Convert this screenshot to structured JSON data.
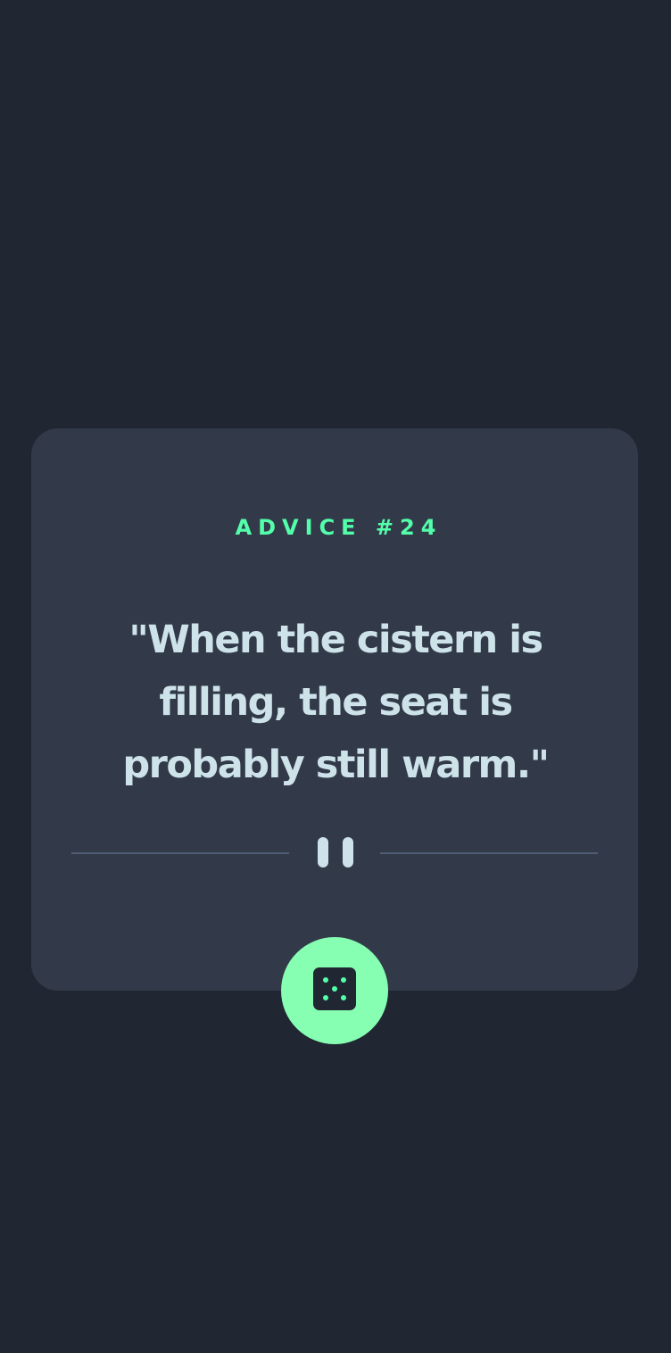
{
  "advice": {
    "label": "ADVICE #24",
    "quote": "\"When the cistern is filling, the seat is probably still warm.\""
  },
  "icons": {
    "divider": "pause-icon",
    "button": "dice-icon"
  },
  "colors": {
    "background": "#202632",
    "card": "#323a49",
    "accent": "#53ffaa",
    "text": "#cee3e9",
    "divider": "#4f5d74"
  }
}
